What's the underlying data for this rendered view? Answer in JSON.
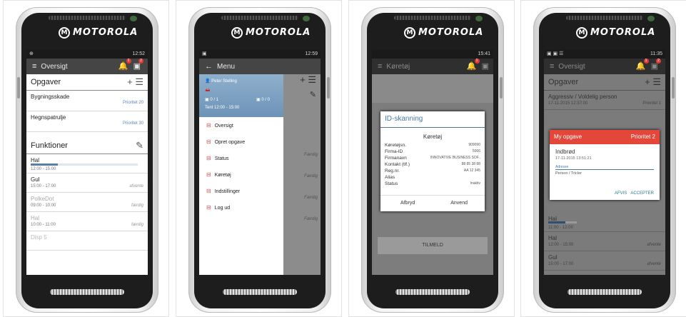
{
  "brand": "MOTOROLA",
  "phones": [
    {
      "status_right": "12:52",
      "title": "Oversigt",
      "sec1": "Opgaver",
      "tasks": [
        {
          "label": "Bygningsskade",
          "priority": "Prioritet 20"
        },
        {
          "label": "Hegnspatrulje",
          "priority": "Prioritet 30"
        }
      ],
      "sec2": "Funktioner",
      "functions": [
        {
          "label": "Hal",
          "time": "12:00 - 15:00",
          "state": "",
          "progress": 0.25
        },
        {
          "label": "Gul",
          "time": "15:00 - 17:00",
          "state": "afvente"
        },
        {
          "label": "PolkeDot",
          "time": "09:00 - 10:00",
          "state": "færdig"
        },
        {
          "label": "Hal",
          "time": "10:00 - 11:00",
          "state": "færdig"
        },
        {
          "label": "Disp 5",
          "time": "",
          "state": ""
        }
      ]
    },
    {
      "status_right": "12:59",
      "title": "Menu",
      "user": "Peter Stelling",
      "counts": {
        "left": "0 / 1",
        "right": "0 / 0"
      },
      "shift": "Tent 12:00 - 15:00",
      "items": [
        "Oversigt",
        "Opret opgave",
        "Status",
        "Køretøj",
        "Indstillinger",
        "Log ud"
      ],
      "behind": [
        "Færdig",
        "Færdig",
        "Færdig",
        "Færdig"
      ]
    },
    {
      "status_right": "15:41",
      "title": "Køretøj",
      "dialog_title": "ID-skanning",
      "dialog_sub": "Køretøj",
      "fields": [
        {
          "k": "Køretøjsn.",
          "v": "909090"
        },
        {
          "k": "Firma-ID",
          "v": "5066"
        },
        {
          "k": "Firmanavn",
          "v": "INNOVATIVE BUSINESS SOF.."
        },
        {
          "k": "Kontakt (tlf.)",
          "v": "88 85 38 88"
        },
        {
          "k": "Reg.nr.",
          "v": "AA 12 345"
        },
        {
          "k": "Alias",
          "v": ""
        },
        {
          "k": "Status",
          "v": "Inaktiv"
        }
      ],
      "cancel": "Afbryd",
      "ok": "Anvend",
      "bottom_btn": "TILMELD"
    },
    {
      "status_right": "11:35",
      "title": "Oversigt",
      "sec1": "Opgaver",
      "task": "Aggressiv / Voldelig person",
      "task_time": "17-11-2015 12:37:00",
      "task_prio": "Prioritet 1",
      "dialog_title": "My opgave",
      "dialog_prio": "Prioritet 2",
      "d_line1": "Indbrød",
      "d_line2": "17-11-2015 13:51:21",
      "d_addr_label": "Adresse",
      "d_addr": "Person / Tricler",
      "btn_reject": "AFVIS",
      "btn_accept": "ACCEPTER",
      "functions": [
        {
          "label": "Hal",
          "time": "11:00 - 12:00",
          "state": ""
        },
        {
          "label": "Hal",
          "time": "12:00 - 15:00",
          "state": "afvente"
        },
        {
          "label": "Gul",
          "time": "15:00 - 17:00",
          "state": "afvente"
        }
      ]
    }
  ]
}
